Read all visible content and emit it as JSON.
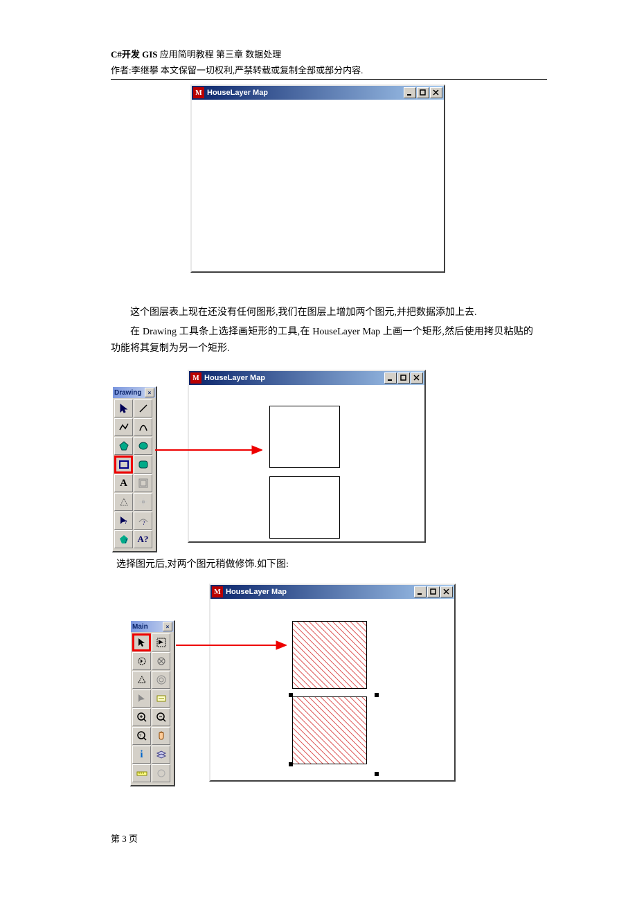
{
  "header": {
    "title_prefix": "C#开发 GIS ",
    "title_rest": "应用简明教程  第三章  数据处理",
    "author_line": "作者:李继攀  本文保留一切权利,严禁转载或复制全部或部分内容."
  },
  "windows": {
    "w1_title": "HouseLayer Map",
    "w2_title": "HouseLayer Map",
    "w3_title": "HouseLayer Map",
    "btn_min": "_",
    "btn_max": "□",
    "btn_close": "×"
  },
  "toolbox": {
    "drawing_title": "Drawing",
    "main_title": "Main",
    "close": "×",
    "drawing_tools": [
      {
        "name": "select-tool",
        "kind": "pointer"
      },
      {
        "name": "line-tool",
        "kind": "line"
      },
      {
        "name": "polyline-tool",
        "kind": "polyline"
      },
      {
        "name": "arc-tool",
        "kind": "arc"
      },
      {
        "name": "polygon-tool",
        "kind": "polygon"
      },
      {
        "name": "ellipse-tool",
        "kind": "ellipse"
      },
      {
        "name": "rectangle-tool",
        "kind": "rect",
        "selected": true
      },
      {
        "name": "roundrect-tool",
        "kind": "roundrect"
      },
      {
        "name": "text-tool",
        "kind": "text"
      },
      {
        "name": "frame-tool",
        "kind": "frame"
      },
      {
        "name": "add-node-tool",
        "kind": "shape"
      },
      {
        "name": "move-node-tool",
        "kind": "move"
      },
      {
        "name": "style-tool",
        "kind": "style"
      },
      {
        "name": "options-tool",
        "kind": "opts"
      },
      {
        "name": "region-style-tool",
        "kind": "regstyle"
      },
      {
        "name": "text-style-tool",
        "kind": "txtstyle"
      }
    ],
    "main_tools": [
      {
        "name": "arrow-tool",
        "kind": "arrow",
        "selected": true
      },
      {
        "name": "select-rect-tool",
        "kind": "selrect"
      },
      {
        "name": "marquee-tool",
        "kind": "marquee"
      },
      {
        "name": "lasso-tool",
        "kind": "lasso"
      },
      {
        "name": "polygon-select-tool",
        "kind": "polysel"
      },
      {
        "name": "circle-select-tool",
        "kind": "circsel"
      },
      {
        "name": "sub-select-tool",
        "kind": "subsel"
      },
      {
        "name": "label-tool",
        "kind": "label"
      },
      {
        "name": "zoom-in-tool",
        "kind": "zoomin"
      },
      {
        "name": "zoom-out-tool",
        "kind": "zoomout"
      },
      {
        "name": "zoom-region-tool",
        "kind": "zoomreg"
      },
      {
        "name": "pan-tool",
        "kind": "pan"
      },
      {
        "name": "info-tool",
        "kind": "info"
      },
      {
        "name": "layer-tool",
        "kind": "layer"
      },
      {
        "name": "ruler-tool",
        "kind": "ruler"
      },
      {
        "name": "extra-tool",
        "kind": "extra"
      }
    ]
  },
  "body": {
    "p1": "这个图层表上现在还没有任何图形,我们在图层上增加两个图元,并把数据添加上去.",
    "p2": "在 Drawing 工具条上选择画矩形的工具,在 HouseLayer Map 上画一个矩形,然后使用拷贝粘贴的功能将其复制为另一个矩形.",
    "p3": "选择图元后,对两个图元稍做修饰.如下图:"
  },
  "footer": {
    "page": "第 3 页"
  }
}
